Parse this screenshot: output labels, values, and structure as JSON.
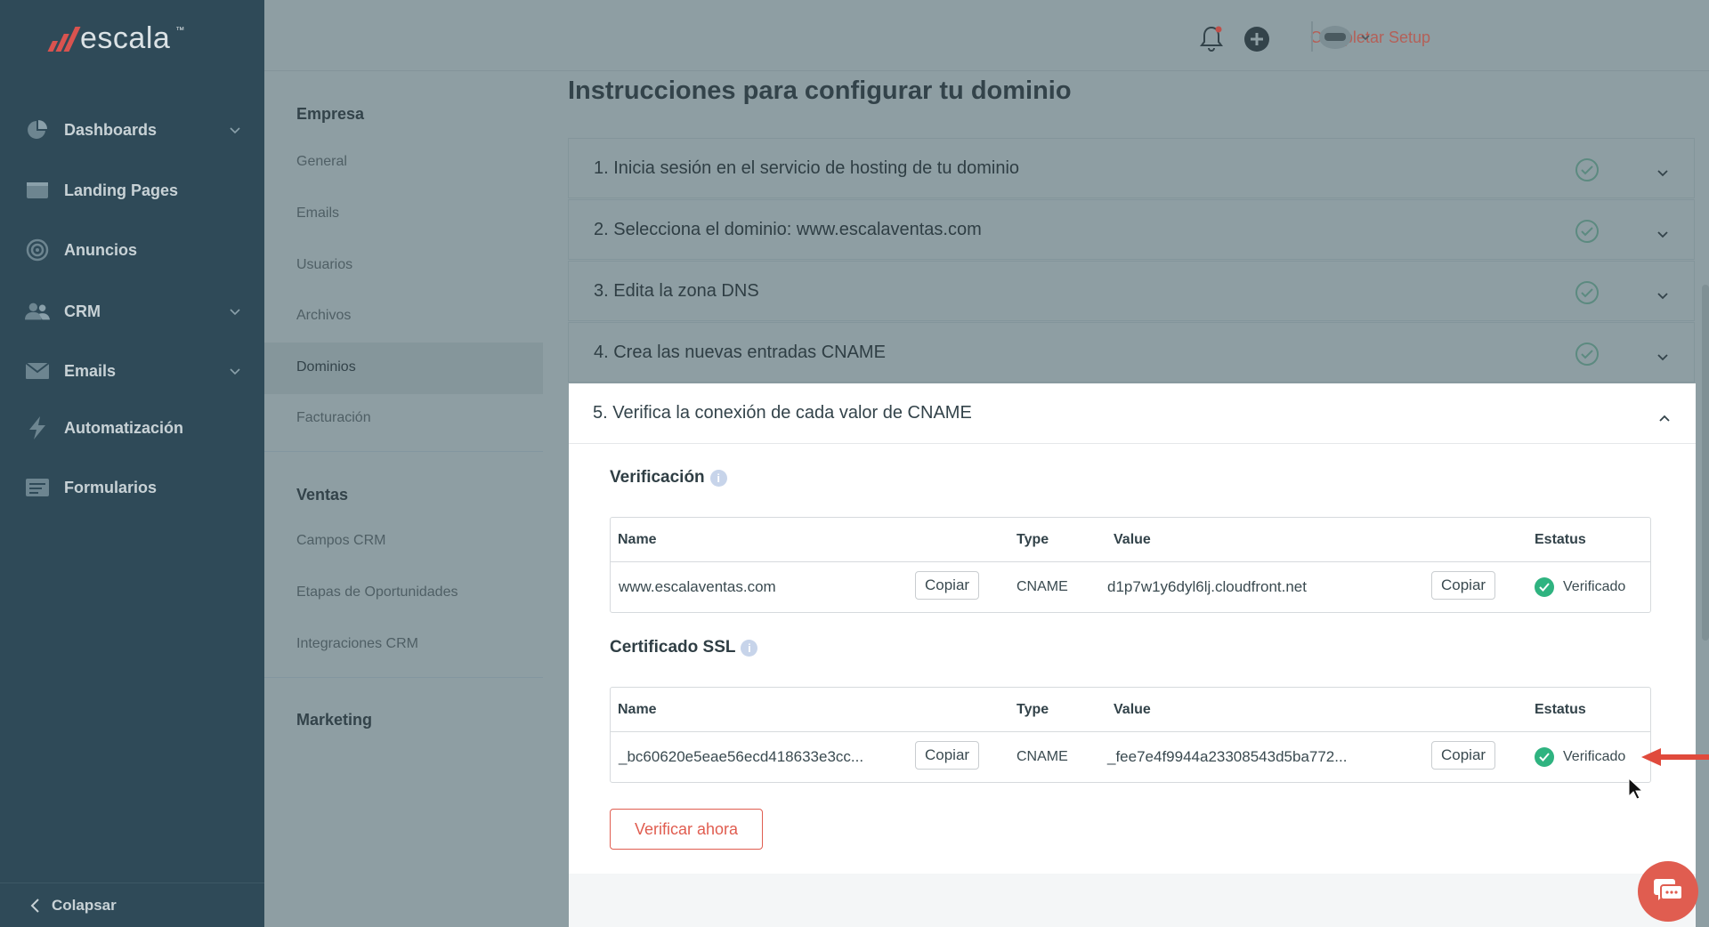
{
  "brand": {
    "name": "escala",
    "tm": "™"
  },
  "sidebar": {
    "items": [
      {
        "label": "Dashboards",
        "icon": "pie-chart-icon",
        "expandable": true
      },
      {
        "label": "Landing Pages",
        "icon": "landing-page-icon",
        "expandable": false
      },
      {
        "label": "Anuncios",
        "icon": "target-icon",
        "expandable": false
      },
      {
        "label": "CRM",
        "icon": "users-icon",
        "expandable": true
      },
      {
        "label": "Emails",
        "icon": "mail-icon",
        "expandable": true
      },
      {
        "label": "Automatización",
        "icon": "lightning-icon",
        "expandable": false
      },
      {
        "label": "Formularios",
        "icon": "form-icon",
        "expandable": false
      }
    ],
    "collapse_label": "Colapsar"
  },
  "topbar": {
    "complete_setup": "Completar Setup"
  },
  "subnav": {
    "empresa_heading": "Empresa",
    "empresa_items": [
      "General",
      "Emails",
      "Usuarios",
      "Archivos",
      "Dominios",
      "Facturación"
    ],
    "selected": "Dominios",
    "ventas_heading": "Ventas",
    "ventas_items": [
      "Campos CRM",
      "Etapas de Oportunidades",
      "Integraciones CRM"
    ],
    "marketing_heading": "Marketing"
  },
  "main": {
    "title": "Instrucciones para configurar tu dominio",
    "steps": [
      "1. Inicia sesión en el servicio de hosting de tu dominio",
      "2. Selecciona el dominio: www.escalaventas.com",
      "3. Edita la zona DNS",
      "4. Crea las nuevas entradas CNAME"
    ],
    "open_step": "5. Verifica la conexión de cada valor de CNAME",
    "verification": {
      "title": "Verificación",
      "headers": {
        "name": "Name",
        "type": "Type",
        "value": "Value",
        "status": "Estatus"
      },
      "row": {
        "name": "www.escalaventas.com",
        "type": "CNAME",
        "value": "d1p7w1y6dyl6lj.cloudfront.net",
        "status": "Verificado"
      }
    },
    "ssl": {
      "title": "Certificado SSL",
      "headers": {
        "name": "Name",
        "type": "Type",
        "value": "Value",
        "status": "Estatus"
      },
      "row": {
        "name": "_bc60620e5eae56ecd418633e3cc...",
        "type": "CNAME",
        "value": "_fee7e4f9944a23308543d5ba772...",
        "status": "Verificado"
      }
    },
    "copy_label": "Copiar",
    "verify_button": "Verificar ahora",
    "info_glyph": "i"
  },
  "colors": {
    "accent": "#e05d50",
    "success": "#2fb380",
    "sidebar": "#2f4a58"
  }
}
